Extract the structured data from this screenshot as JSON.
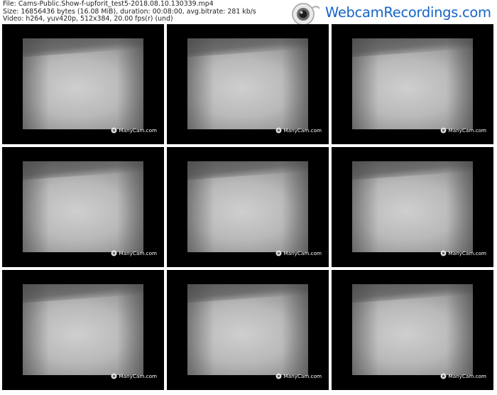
{
  "info": {
    "file_line": "File: Cams-Public.Show-f-upforit_test5-2018.08.10.130339.mp4",
    "size_line": "Size: 16856436 bytes (16.08 MiB), duration: 00:08:00, avg.bitrate: 281 kb/s",
    "video_line": "Video: h264, yuv420p, 512x384, 20.00 fps(r) (und)"
  },
  "logo": {
    "icon": "webcam-icon",
    "text": "WebcamRecordings.com"
  },
  "thumbnails": [
    {
      "watermark": "ManyCam.com"
    },
    {
      "watermark": "ManyCam.com"
    },
    {
      "watermark": "ManyCam.com"
    },
    {
      "watermark": "ManyCam.com"
    },
    {
      "watermark": "ManyCam.com"
    },
    {
      "watermark": "ManyCam.com"
    },
    {
      "watermark": "ManyCam.com"
    },
    {
      "watermark": "ManyCam.com"
    },
    {
      "watermark": "ManyCam.com"
    }
  ],
  "colors": {
    "background": "#ffffff",
    "thumb_border": "#000000",
    "logo_blue": "#1565c8"
  }
}
